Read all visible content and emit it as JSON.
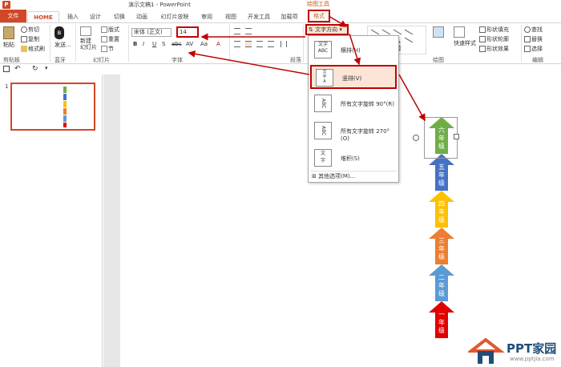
{
  "window": {
    "title": "演示文稿1 - PowerPoint",
    "context_group": "绘图工具"
  },
  "tabs": [
    "文件",
    "HOME",
    "插入",
    "设计",
    "切换",
    "动画",
    "幻灯片放映",
    "审阅",
    "视图",
    "开发工具",
    "加载项",
    "格式"
  ],
  "ribbon": {
    "paste": "粘贴",
    "cut": "剪切",
    "copy": "复制",
    "format_painter": "格式刷",
    "clipboard_label": "剪贴板",
    "bluetooth_label": "蓝牙",
    "send": "发送...",
    "new_slide": "新建\n幻灯片",
    "layout": "版式",
    "reset": "重置",
    "section": "节",
    "slides_label": "幻灯片",
    "font_name": "宋体 (正文)",
    "font_size": "14",
    "font_label": "字体",
    "paragraph_label": "段落",
    "text_direction": "文字方向",
    "drawing_label": "绘图",
    "quick_styles": "快速样式",
    "shape_fill": "形状填充",
    "shape_outline": "形状轮廓",
    "shape_effects": "形状效果",
    "find": "查找",
    "replace": "替换",
    "select": "选择",
    "editing_label": "编辑"
  },
  "dropdown": {
    "items": [
      {
        "label": "横排(H)",
        "icon_text": "文字\nABC"
      },
      {
        "label": "竖排(V)",
        "icon_text": "文\n字\nA"
      },
      {
        "label": "所有文字旋转 90°(R)",
        "icon_text": "ABC"
      },
      {
        "label": "所有文字旋转 270°(O)",
        "icon_text": "ABC"
      },
      {
        "label": "堆积(S)",
        "icon_text": "文\n字"
      }
    ],
    "more": "其他选项(M)..."
  },
  "slide_panel": {
    "slide_number": "1"
  },
  "arrows": [
    {
      "label": "六\n年\n级",
      "color": "#70ad47",
      "selected": true
    },
    {
      "label": "五\n年\n级",
      "color": "#4472c4"
    },
    {
      "label": "四\n年\n级",
      "color": "#ffc000"
    },
    {
      "label": "三\n年\n级",
      "color": "#ed7d31"
    },
    {
      "label": "二\n年\n级",
      "color": "#5b9bd5"
    },
    {
      "label": "一\n年\n级",
      "color": "#e00000"
    }
  ],
  "watermark": {
    "title": "PPT家园",
    "url": "www.pptjia.com"
  },
  "colors": {
    "accent": "#d24726",
    "highlight": "#c00000"
  }
}
